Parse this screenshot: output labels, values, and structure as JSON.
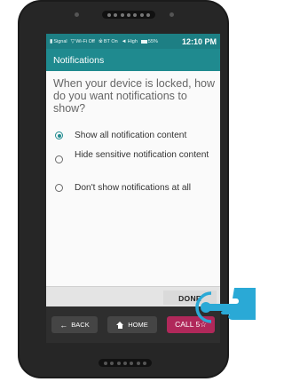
{
  "status_bar": {
    "signal_label": "Signal",
    "wifi_label": "Wi-Fi Off",
    "bluetooth_label": "BT On",
    "volume_label": "High",
    "battery_label": "55%",
    "time": "12:10 PM"
  },
  "header": {
    "title": "Notifications"
  },
  "question": "When your device is locked, how do you want notifications to show?",
  "options": [
    {
      "label": "Show all notification content",
      "selected": true
    },
    {
      "label": "Hide sensitive notification content",
      "selected": false
    },
    {
      "label": "Don't show notifications at all",
      "selected": false
    }
  ],
  "done_label": "DONE",
  "nav": {
    "back_label": "BACK",
    "home_label": "HOME",
    "call_label": "CALL 5☆"
  },
  "colors": {
    "accent": "#1f8a8f",
    "status_bar": "#1d7f84",
    "call_button": "#b0285a",
    "hand": "#2aa9d6"
  },
  "icons": {
    "back": "arrow-left-icon",
    "home": "house-icon",
    "touch": "pointing-hand-icon"
  }
}
